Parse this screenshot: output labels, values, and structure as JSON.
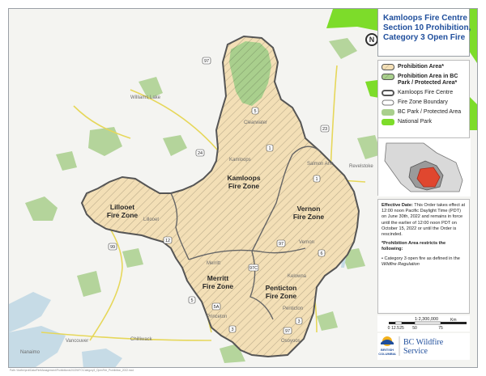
{
  "title": {
    "line1": "Kamloops Fire Centre",
    "line2": "Section 10 Prohibition,",
    "line3": "Category 3 Open Fire"
  },
  "north_arrow": {
    "label": "N"
  },
  "legend": [
    {
      "id": "prohibition",
      "label": "Prohibition Area*",
      "bold": true,
      "swatch": "hatch-tan"
    },
    {
      "id": "prohibition-park",
      "label": "Prohibition Area in BC",
      "label2": "Park / Protected Area*",
      "bold": true,
      "swatch": "hatch-green"
    },
    {
      "id": "kfc",
      "label": "Kamloops Fire Centre",
      "bold": false,
      "swatch": "outline-thick"
    },
    {
      "id": "zone",
      "label": "Fire Zone Boundary",
      "bold": false,
      "swatch": "outline-thin"
    },
    {
      "id": "park",
      "label": "BC Park / Protected Area",
      "bold": false,
      "swatch": "fill-park"
    },
    {
      "id": "national",
      "label": "National Park",
      "bold": false,
      "swatch": "fill-national"
    }
  ],
  "notes": {
    "effective_label": "Effective Date:",
    "effective_text": " This Order takes effect at 12:00 noon Pacific Daylight Time (PDT) on June 30th, 2022 and remains in force until the earlier of 12:00 noon PDT on October 15, 2022 or until the Order is rescinded.",
    "restrict_label": "*Prohibition Area restricts the following:",
    "bullet_text": "• Category 3 open fire as defined in the ",
    "bullet_italic": "Wildfire Regulation"
  },
  "scale": {
    "ratio": "1:2,300,000",
    "ticks": [
      "0",
      "12.5",
      "25",
      "50",
      "75"
    ],
    "unit": "Km"
  },
  "logo": {
    "org_line1": "BC Wildfire",
    "org_line2": "Service",
    "gov_line1": "BRITISH",
    "gov_line2": "COLUMBIA"
  },
  "zones": [
    {
      "name": "Kamloops",
      "line2": "Fire Zone"
    },
    {
      "name": "Lillooet",
      "line2": "Fire Zone"
    },
    {
      "name": "Vernon",
      "line2": "Fire Zone"
    },
    {
      "name": "Merritt",
      "line2": "Fire Zone"
    },
    {
      "name": "Penticton",
      "line2": "Fire Zone"
    }
  ],
  "places": [
    "Williams Lake",
    "Clearwater",
    "Salmon Arm",
    "Revelstoke",
    "Kamloops",
    "Lillooet",
    "Vernon",
    "Kelowna",
    "Merritt",
    "Penticton",
    "Princeton",
    "Vancouver",
    "Nanaimo",
    "Chilliwack",
    "Osoyoos"
  ],
  "highways": [
    "97",
    "5",
    "24",
    "1",
    "23",
    "99",
    "12",
    "97",
    "1",
    "6",
    "97C",
    "5A",
    "5",
    "3",
    "97",
    "3"
  ],
  "colors": {
    "prohibition_fill": "#f3dfb6",
    "hatch": "#b7a888",
    "park": "#a9cf8d",
    "national_park": "#7ddc2a",
    "water": "#c6dbe6",
    "road": "#e6d75a",
    "boundary": "#555555",
    "title_blue": "#1f4e9c"
  },
  "footer": "Path: \\\\bcfire\\prot\\Data\\FireManagement\\Prohibitions\\2022\\KFC\\Category3_OpenFire_Prohibition_2022.mxd"
}
